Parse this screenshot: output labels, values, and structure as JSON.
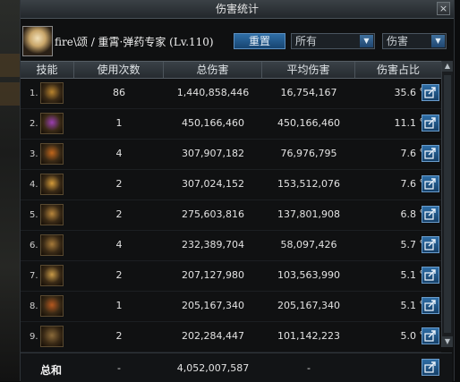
{
  "window": {
    "title": "伤害统计",
    "close_label": "×"
  },
  "player": {
    "name": "fire\\颂 / 重霄·弹药专家 (Lv.110)"
  },
  "controls": {
    "reset_label": "重置",
    "filter_select": {
      "value": "所有"
    },
    "metric_select": {
      "value": "伤害"
    }
  },
  "columns": {
    "skill": "技能",
    "uses": "使用次数",
    "total": "总伤害",
    "avg": "平均伤害",
    "share": "伤害占比"
  },
  "rows": [
    {
      "index": "1.",
      "uses": "86",
      "total": "1,440,858,446",
      "avg": "16,754,167",
      "pct": "35.6",
      "pct_unit": "%",
      "icon": "grenade-skill-icon",
      "color": "#b8832e"
    },
    {
      "index": "2.",
      "uses": "1",
      "total": "450,166,460",
      "avg": "450,166,460",
      "pct": "11.1",
      "pct_unit": "%",
      "icon": "laser-beam-skill-icon",
      "color": "#9a3fb0"
    },
    {
      "index": "3.",
      "uses": "4",
      "total": "307,907,182",
      "avg": "76,976,795",
      "pct": "7.6",
      "pct_unit": "%",
      "icon": "flame-burst-skill-icon",
      "color": "#c0661c"
    },
    {
      "index": "4.",
      "uses": "2",
      "total": "307,024,152",
      "avg": "153,512,076",
      "pct": "7.6",
      "pct_unit": "%",
      "icon": "explosion-skill-icon",
      "color": "#d39a3a"
    },
    {
      "index": "5.",
      "uses": "2",
      "total": "275,603,816",
      "avg": "137,801,908",
      "pct": "6.8",
      "pct_unit": "%",
      "icon": "rocket-volley-skill-icon",
      "color": "#b8863c"
    },
    {
      "index": "6.",
      "uses": "4",
      "total": "232,389,704",
      "avg": "58,097,426",
      "pct": "5.7",
      "pct_unit": "%",
      "icon": "shell-blast-skill-icon",
      "color": "#a67a3a"
    },
    {
      "index": "7.",
      "uses": "2",
      "total": "207,127,980",
      "avg": "103,563,990",
      "pct": "5.1",
      "pct_unit": "%",
      "icon": "spike-field-skill-icon",
      "color": "#c89a48"
    },
    {
      "index": "8.",
      "uses": "1",
      "total": "205,167,340",
      "avg": "205,167,340",
      "pct": "5.1",
      "pct_unit": "%",
      "icon": "cannon-strike-skill-icon",
      "color": "#b5581f"
    },
    {
      "index": "9.",
      "uses": "2",
      "total": "202,284,447",
      "avg": "101,142,223",
      "pct": "5.0",
      "pct_unit": "%",
      "icon": "vortex-skill-icon",
      "color": "#8a6a3a"
    }
  ],
  "total": {
    "label": "总和",
    "uses": "-",
    "total": "4,052,007,587",
    "avg": "-"
  }
}
